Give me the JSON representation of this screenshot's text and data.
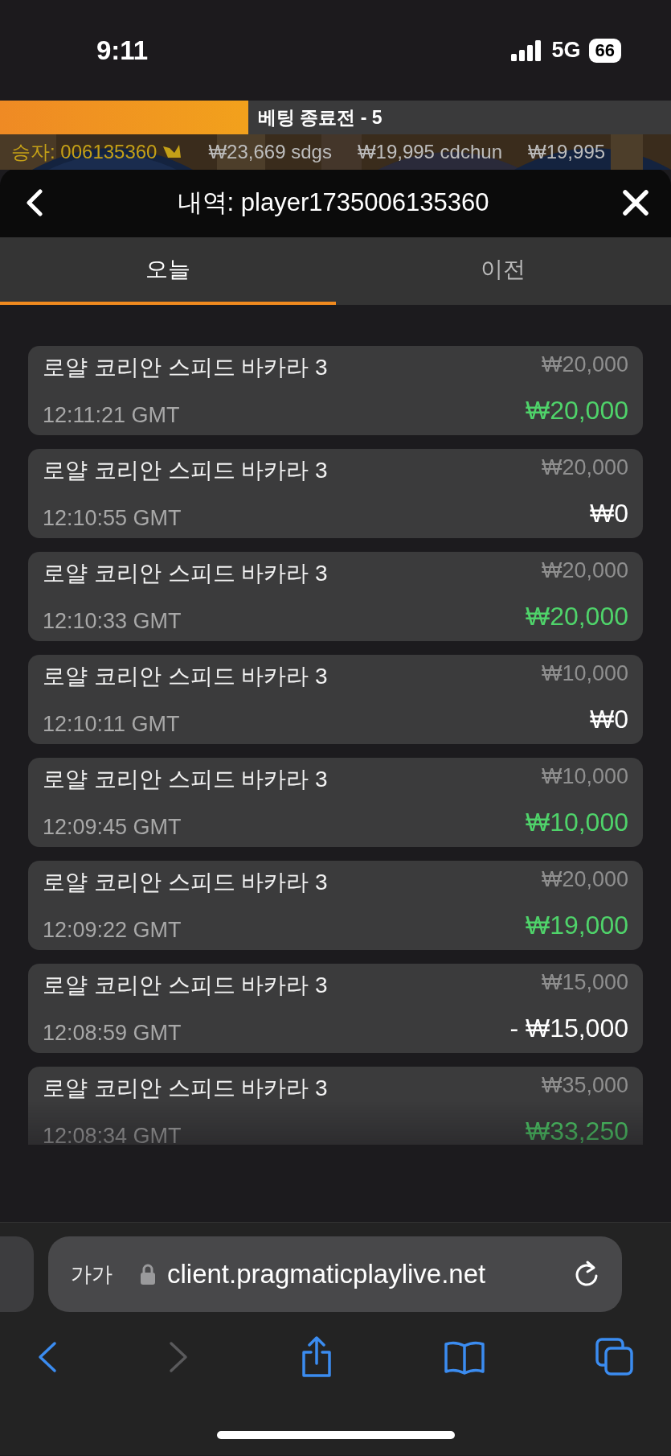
{
  "status_bar": {
    "time": "9:11",
    "network": "5G",
    "battery": "66"
  },
  "countdown": {
    "label": "베팅 종료전 - 5",
    "level": 0.37
  },
  "ticker": [
    {
      "kind": "winner",
      "text": "승자: 006135360"
    },
    {
      "kind": "win",
      "text": "₩23,669 sdgs"
    },
    {
      "kind": "win",
      "text": "₩19,995 cdchun"
    },
    {
      "kind": "win",
      "text": "₩19,995"
    }
  ],
  "header": {
    "title": "내역: player1735006135360"
  },
  "tabs": [
    {
      "label": "오늘",
      "selected": true
    },
    {
      "label": "이전",
      "selected": false
    }
  ],
  "bets": [
    {
      "game": "로얄 코리안 스피드 바카라 3",
      "time": "12:11:21 GMT",
      "stake": "₩20,000",
      "result": "₩20,000",
      "win": true
    },
    {
      "game": "로얄 코리안 스피드 바카라 3",
      "time": "12:10:55 GMT",
      "stake": "₩20,000",
      "result": "₩0",
      "win": false
    },
    {
      "game": "로얄 코리안 스피드 바카라 3",
      "time": "12:10:33 GMT",
      "stake": "₩20,000",
      "result": "₩20,000",
      "win": true
    },
    {
      "game": "로얄 코리안 스피드 바카라 3",
      "time": "12:10:11 GMT",
      "stake": "₩10,000",
      "result": "₩0",
      "win": false
    },
    {
      "game": "로얄 코리안 스피드 바카라 3",
      "time": "12:09:45 GMT",
      "stake": "₩10,000",
      "result": "₩10,000",
      "win": true
    },
    {
      "game": "로얄 코리안 스피드 바카라 3",
      "time": "12:09:22 GMT",
      "stake": "₩20,000",
      "result": "₩19,000",
      "win": true
    },
    {
      "game": "로얄 코리안 스피드 바카라 3",
      "time": "12:08:59 GMT",
      "stake": "₩15,000",
      "result": "- ₩15,000",
      "win": false
    },
    {
      "game": "로얄 코리안 스피드 바카라 3",
      "time": "12:08:34 GMT",
      "stake": "₩35,000",
      "result": "₩33,250",
      "win": true
    }
  ],
  "browser": {
    "text_size": "가가",
    "url": "client.pragmaticplaylive.net",
    "forward_disabled": true
  }
}
